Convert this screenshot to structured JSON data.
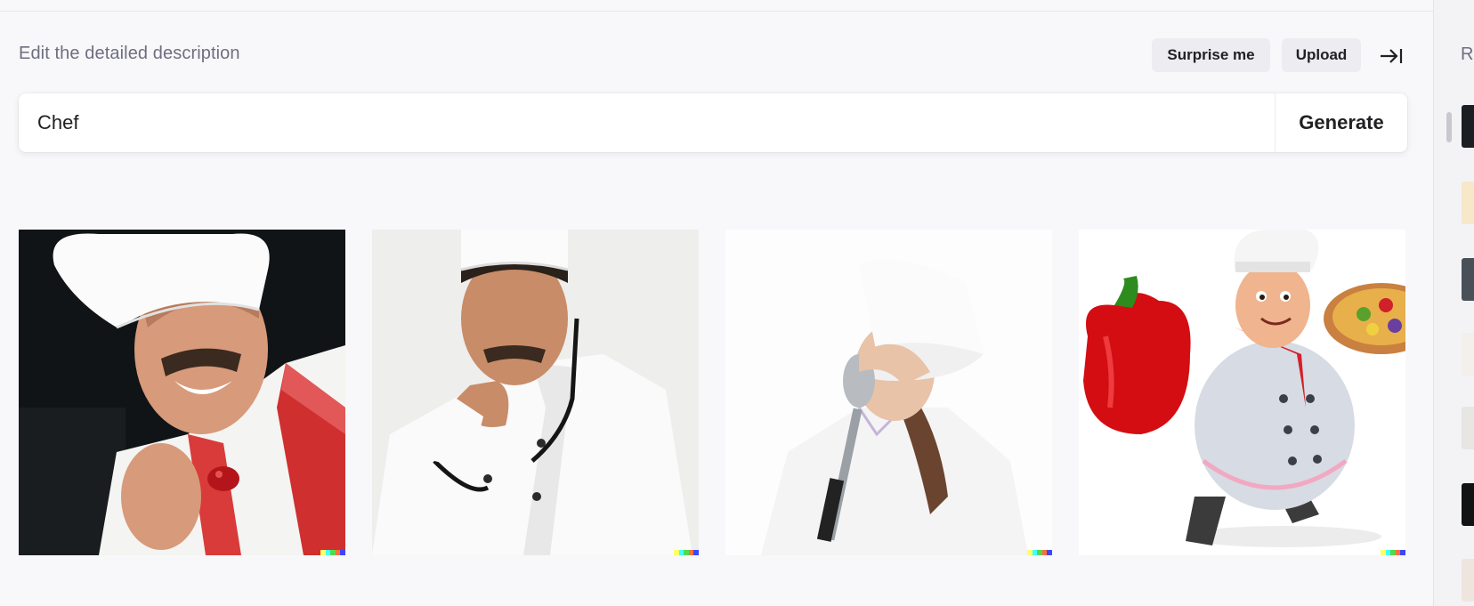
{
  "header": {
    "title": "Edit the detailed description",
    "surprise_label": "Surprise me",
    "upload_label": "Upload",
    "collapse_icon": "collapse-right-icon"
  },
  "prompt": {
    "value": "Chef",
    "generate_label": "Generate"
  },
  "results": [
    {
      "name": "smiling-chef-with-tomato"
    },
    {
      "name": "thinking-chef"
    },
    {
      "name": "chef-with-ladle"
    },
    {
      "name": "cartoon-chef-with-pepper"
    }
  ],
  "signature_colors": [
    "#ffff66",
    "#42ffff",
    "#51da4c",
    "#ff6e3c",
    "#3c46ff"
  ],
  "sidebar": {
    "label": "R"
  },
  "colors": {
    "background": "#f8f8fa",
    "button_bg": "#ececf1",
    "text": "#202123",
    "muted": "#6e6e80"
  }
}
